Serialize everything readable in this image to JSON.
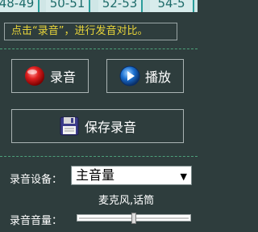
{
  "tabs": [
    "48-49",
    "50-51",
    "52-53",
    "54-5"
  ],
  "hint": "点击“录音”，进行发音对比。",
  "record_button": {
    "label": "录音",
    "icon": "record-icon"
  },
  "play_button": {
    "label": "播放",
    "icon": "play-icon"
  },
  "save_button": {
    "label": "保存录音",
    "icon": "floppy-disk-icon"
  },
  "device": {
    "label": "录音设备：",
    "selected": "主音量",
    "description": "麦克风,话筒"
  },
  "volume": {
    "label": "录音音量：",
    "level": 0.5
  },
  "colors": {
    "background": "#2e3d3d",
    "hint_text": "#e8d53a",
    "record": "#e02020",
    "play": "#1a6fd0"
  }
}
